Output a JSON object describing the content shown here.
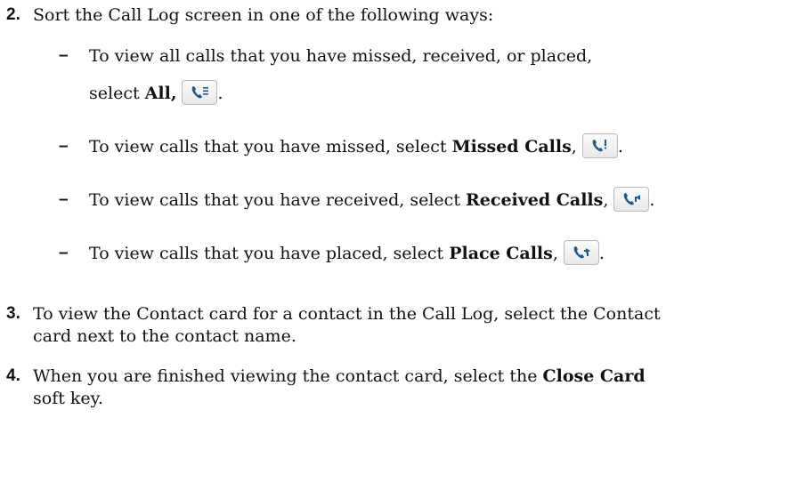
{
  "steps": [
    {
      "number": "2.",
      "text": "Sort the Call Log screen in one of the following ways:"
    },
    {
      "number": "3.",
      "line1": "To view the Contact card for a contact in the Call Log, select the Contact",
      "line2": "card next to the contact name."
    },
    {
      "number": "4.",
      "line1_pre": "When you are finished viewing the contact card, select the ",
      "line1_bold": "Close Card",
      "line2": "soft key."
    }
  ],
  "options": [
    {
      "line1": "To view all calls that you have missed, received, or placed,",
      "pre": "select ",
      "bold": "All,",
      "post": "",
      "icon": "all-calls-icon"
    },
    {
      "pre": "To view calls that you have missed, select ",
      "bold": "Missed Calls",
      "post": ",",
      "icon": "missed-calls-icon"
    },
    {
      "pre": "To view calls that you have received, select ",
      "bold": "Received Calls",
      "post": ",",
      "icon": "received-calls-icon"
    },
    {
      "pre": "To view calls that you have placed, select ",
      "bold": "Place Calls",
      "post": ",",
      "icon": "placed-calls-icon"
    }
  ],
  "dash": "–",
  "period": "."
}
